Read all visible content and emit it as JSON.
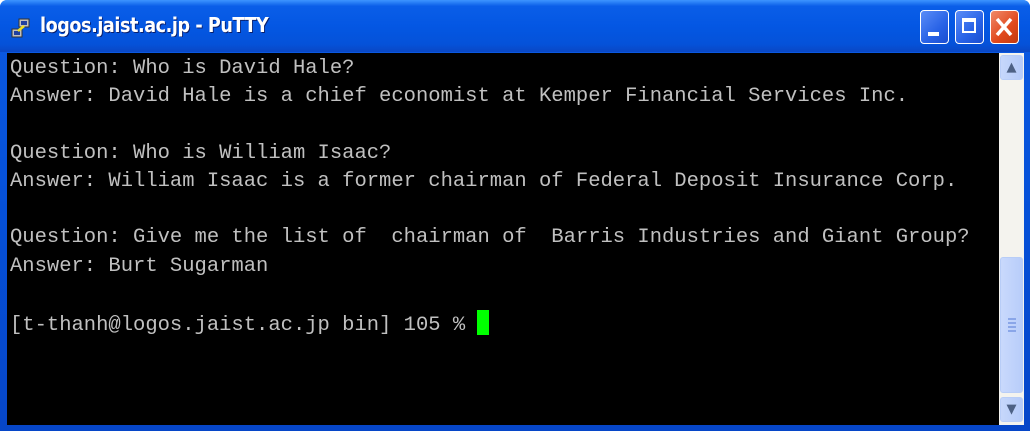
{
  "window": {
    "title": "logos.jaist.ac.jp - PuTTY"
  },
  "terminal": {
    "lines": [
      "Question: Who is David Hale?",
      "Answer: David Hale is a chief economist at Kemper Financial Services Inc.",
      "",
      "Question: Who is William Isaac?",
      "Answer: William Isaac is a former chairman of Federal Deposit Insurance Corp.",
      "",
      "Question: Give me the list of  chairman of  Barris Industries and Giant Group?",
      "Answer: Burt Sugarman",
      "",
      "[t-thanh@logos.jaist.ac.jp bin] 105 % "
    ],
    "cursor_color": "#00ff00"
  },
  "scrollbar": {
    "up": "▲",
    "down": "▼",
    "position_fraction": 1.0
  }
}
